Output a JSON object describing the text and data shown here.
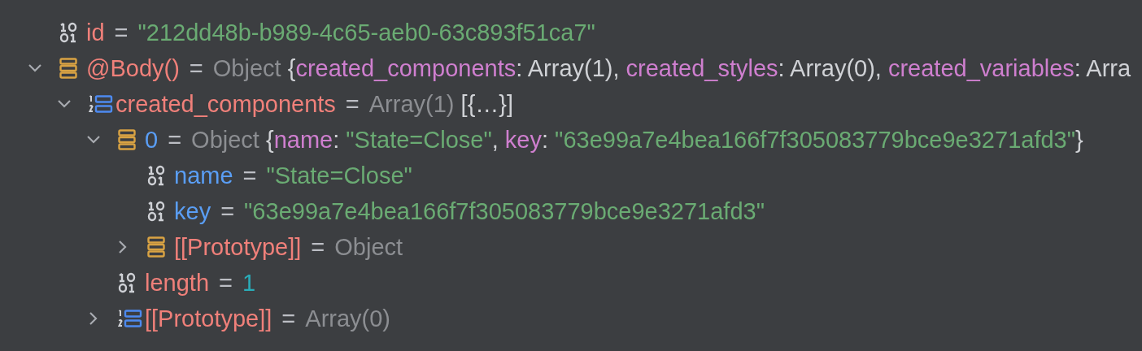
{
  "variables": [
    {
      "name": "id",
      "color": "#f0807a",
      "kind": "primitive",
      "value": [
        {
          "kind": "op",
          "text": "="
        },
        {
          "kind": "string",
          "text": "\"212dd48b-b989-4c65-aeb0-63c893f51ca7\""
        }
      ]
    },
    {
      "name": "@Body()",
      "color": "#f0807a",
      "kind": "object",
      "expanded": true,
      "value": [
        {
          "kind": "op",
          "text": "="
        },
        {
          "kind": "type",
          "text": "Object"
        },
        {
          "kind": "punct",
          "text": " {"
        },
        {
          "kind": "key",
          "text": "created_components"
        },
        {
          "kind": "punct",
          "text": ": Array(1), "
        },
        {
          "kind": "key",
          "text": "created_styles"
        },
        {
          "kind": "punct",
          "text": ": Array(0), "
        },
        {
          "kind": "key",
          "text": "created_variables"
        },
        {
          "kind": "punct",
          "text": ": Arra"
        }
      ],
      "children": [
        {
          "name": "created_components",
          "color": "#f0807a",
          "kind": "array",
          "expanded": true,
          "value": [
            {
              "kind": "op",
              "text": "="
            },
            {
              "kind": "type",
              "text": "Array(1)"
            },
            {
              "kind": "punct",
              "text": " [{…}]"
            }
          ],
          "children": [
            {
              "name": "0",
              "color": "#5a9ef5",
              "kind": "object",
              "expanded": true,
              "value": [
                {
                  "kind": "op",
                  "text": "="
                },
                {
                  "kind": "type",
                  "text": "Object"
                },
                {
                  "kind": "punct",
                  "text": " {"
                },
                {
                  "kind": "key",
                  "text": "name"
                },
                {
                  "kind": "punct",
                  "text": ": "
                },
                {
                  "kind": "string",
                  "text": "\"State=Close\""
                },
                {
                  "kind": "punct",
                  "text": ", "
                },
                {
                  "kind": "key",
                  "text": "key"
                },
                {
                  "kind": "punct",
                  "text": ": "
                },
                {
                  "kind": "string",
                  "text": "\"63e99a7e4bea166f7f305083779bce9e3271afd3\""
                },
                {
                  "kind": "punct",
                  "text": "}"
                }
              ],
              "children": [
                {
                  "name": "name",
                  "color": "#5a9ef5",
                  "kind": "primitive",
                  "value": [
                    {
                      "kind": "op",
                      "text": "="
                    },
                    {
                      "kind": "string",
                      "text": "\"State=Close\""
                    }
                  ]
                },
                {
                  "name": "key",
                  "color": "#5a9ef5",
                  "kind": "primitive",
                  "value": [
                    {
                      "kind": "op",
                      "text": "="
                    },
                    {
                      "kind": "string",
                      "text": "\"63e99a7e4bea166f7f305083779bce9e3271afd3\""
                    }
                  ]
                },
                {
                  "name": "[[Prototype]]",
                  "color": "#f0807a",
                  "kind": "object",
                  "expanded": false,
                  "value": [
                    {
                      "kind": "op",
                      "text": "="
                    },
                    {
                      "kind": "type",
                      "text": "Object"
                    }
                  ]
                }
              ]
            },
            {
              "name": "length",
              "color": "#f0807a",
              "kind": "primitive",
              "value": [
                {
                  "kind": "op",
                  "text": "="
                },
                {
                  "kind": "number",
                  "text": "1"
                }
              ]
            },
            {
              "name": "[[Prototype]]",
              "color": "#f0807a",
              "kind": "array",
              "expanded": false,
              "value": [
                {
                  "kind": "op",
                  "text": "="
                },
                {
                  "kind": "type",
                  "text": "Array(0)"
                }
              ]
            }
          ]
        }
      ]
    }
  ]
}
